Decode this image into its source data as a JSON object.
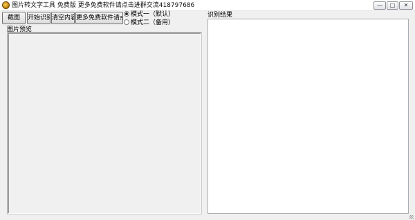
{
  "window": {
    "title": "图片转文字工具 免费版 更多免费软件请点击进群交流418797686",
    "controls": {
      "minimize": "—",
      "maximize": "□",
      "close": "✕"
    }
  },
  "toolbar": {
    "screenshot_label": "截图",
    "start_label": "开始识别",
    "clear_label": "清空内容",
    "more_label": "更多免费软件请点击"
  },
  "mode": {
    "option1": "模式一（默认）",
    "option2": "模式二（备用）",
    "selected": "option1"
  },
  "preview": {
    "label": "图片预览"
  },
  "result": {
    "label": "识别结果",
    "value": ""
  }
}
